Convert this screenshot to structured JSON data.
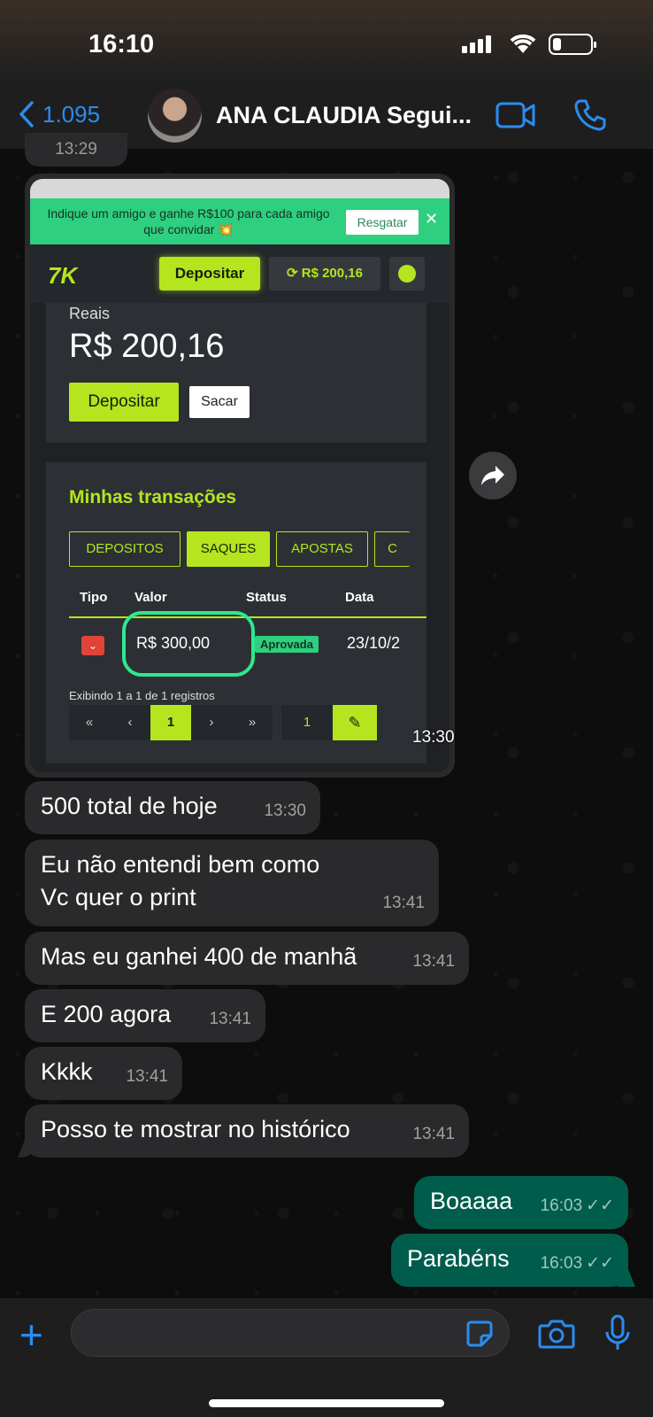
{
  "status_bar": {
    "time": "16:10"
  },
  "header": {
    "back_count": "1.095",
    "contact_name": "ANA CLAUDIA Segui..."
  },
  "prev_time": "13:29",
  "image_message": {
    "time": "13:30",
    "banner_text": "Indique um amigo e ganhe R$100 para cada amigo que convidar 💥",
    "banner_button": "Resgatar",
    "banner_close": "✕",
    "logo": "7K",
    "nav_deposit": "Depositar",
    "nav_balance": "R$ 200,16",
    "card_label": "Reais",
    "card_balance": "R$ 200,16",
    "card_deposit": "Depositar",
    "card_withdraw": "Sacar",
    "transactions_title": "Minhas transações",
    "tabs": [
      "DEPOSITOS",
      "SAQUES",
      "APOSTAS",
      "C"
    ],
    "active_tab": "SAQUES",
    "table_headers": {
      "tipo": "Tipo",
      "valor": "Valor",
      "status": "Status",
      "data": "Data"
    },
    "row": {
      "valor": "R$ 300,00",
      "status": "Aprovada",
      "data": "23/10/2"
    },
    "records_info": "Exibindo 1 a 1 de 1 registros",
    "pager": [
      "«",
      "‹",
      "1",
      "›",
      "»"
    ],
    "page_size": "1"
  },
  "messages": [
    {
      "dir": "in",
      "text": "500 total de hoje",
      "time": "13:30"
    },
    {
      "dir": "in",
      "text": "Eu não entendi bem como\nVc quer o print",
      "line1": "Eu não entendi bem como",
      "line2": "Vc quer o print",
      "time": "13:41"
    },
    {
      "dir": "in",
      "text": "Mas eu ganhei 400 de manhã",
      "time": "13:41"
    },
    {
      "dir": "in",
      "text": "E 200 agora",
      "time": "13:41"
    },
    {
      "dir": "in",
      "text": "Kkkk",
      "time": "13:41"
    },
    {
      "dir": "in",
      "text": "Posso te mostrar no histórico",
      "time": "13:41"
    },
    {
      "dir": "out",
      "text": "Boaaaa",
      "time": "16:03"
    },
    {
      "dir": "out",
      "text": "Parabéns",
      "time": "16:03"
    }
  ],
  "input": {
    "placeholder": ""
  },
  "colors": {
    "accent_blue": "#2b8cf0",
    "incoming_bubble": "#2a2a2c",
    "outgoing_bubble": "#015d4b",
    "site_lime": "#b5e51f",
    "site_green": "#2ecf7e"
  }
}
